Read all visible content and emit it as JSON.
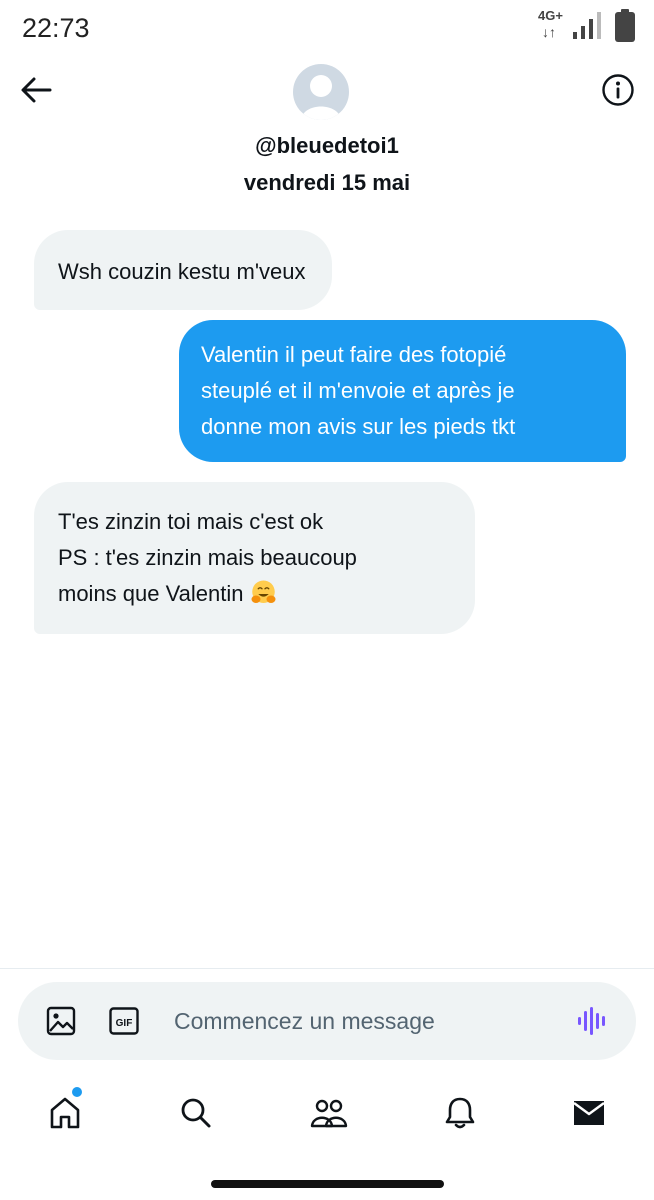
{
  "status_bar": {
    "time": "22:73",
    "network": "4G+",
    "network_arrows": "↓↑",
    "icons": [
      "signal-icon",
      "battery-icon"
    ]
  },
  "header": {
    "handle": "@bleuedetoi1",
    "date": "vendredi 15 mai",
    "icons": [
      "back-arrow-icon",
      "avatar-placeholder-icon",
      "info-icon"
    ]
  },
  "messages": [
    {
      "direction": "received",
      "lines": [
        "Wsh couzin kestu m'veux"
      ]
    },
    {
      "direction": "sent",
      "lines": [
        "Valentin il peut faire des fotopié",
        "steuplé et il m'envoie et après je",
        "donne mon avis sur les pieds tkt"
      ]
    },
    {
      "direction": "received",
      "lines": [
        "T'es zinzin toi mais c'est ok",
        "PS : t'es zinzin mais beaucoup",
        "moins que Valentin"
      ],
      "emoji": "hugging-face-emoji"
    }
  ],
  "composer": {
    "placeholder": "Commencez un message",
    "gif_label": "GIF",
    "icons": [
      "image-icon",
      "gif-icon",
      "voice-wave-icon"
    ]
  },
  "bottom_nav": {
    "items": [
      "home-icon",
      "search-icon",
      "communities-icon",
      "notifications-icon",
      "messages-icon"
    ],
    "active": "messages-icon",
    "home_has_badge_dot": true
  },
  "colors": {
    "accent": "#1d9bf0",
    "received_bubble": "#eff3f4",
    "text": "#0f1419",
    "placeholder": "#536471",
    "voice_icon": "#7856ff"
  }
}
